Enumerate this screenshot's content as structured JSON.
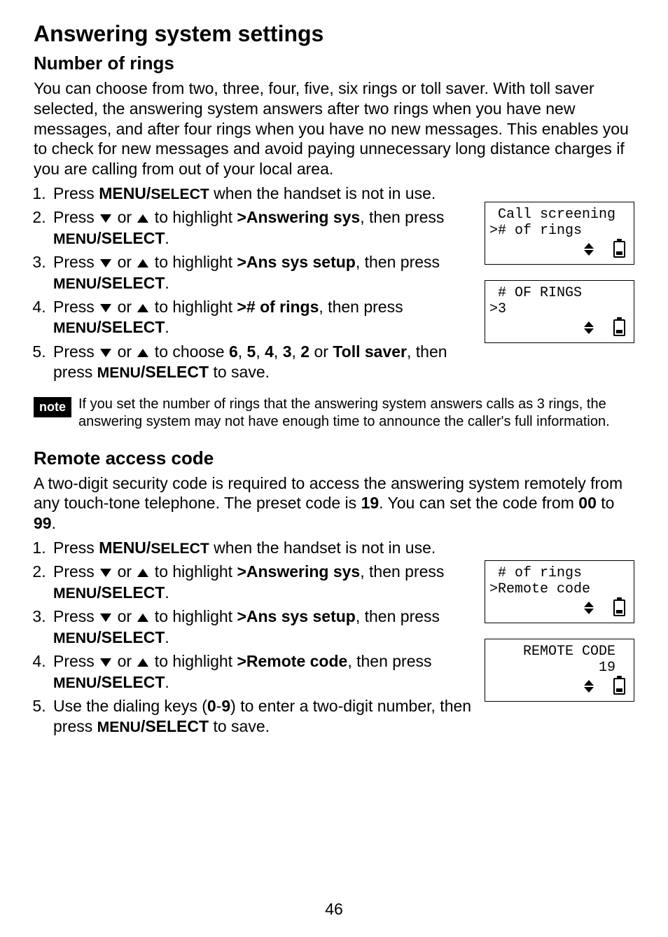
{
  "page": {
    "title": "Answering system settings",
    "number": "46"
  },
  "section1": {
    "heading": "Number of rings",
    "intro": "You can choose from two, three, four, five, six rings or toll saver. With toll saver selected, the answering system answers after two rings when you have new messages, and after four rings when you have no new messages. This enables you to check for new messages and avoid paying unnecessary long distance charges if you are calling from out of your local area.",
    "steps": {
      "s1_a": "Press ",
      "s1_b": "MENU/",
      "s1_c": "SELECT",
      "s1_d": " when the handset is not in use.",
      "s2_a": "Press ",
      "s2_or": " or ",
      "s2_b": " to highlight ",
      "s2_c": ">Answering sys",
      "s2_d": ", then press ",
      "s2_e": "MENU",
      "s2_f": "/SELECT",
      "s2_g": ".",
      "s3_a": "Press ",
      "s3_or": " or ",
      "s3_b": " to highlight ",
      "s3_c": ">Ans sys setup",
      "s3_d": ", then press ",
      "s3_e": "MENU",
      "s3_f": "/SELECT",
      "s3_g": ".",
      "s4_a": "Press ",
      "s4_or": " or ",
      "s4_b": " to highlight ",
      "s4_c": "># of rings",
      "s4_d": ", then press ",
      "s4_e": "MENU",
      "s4_f": "/SELECT",
      "s4_g": ".",
      "s5_a": "Press ",
      "s5_or": " or ",
      "s5_b": " to choose ",
      "s5_c6": "6",
      "s5_c5": "5",
      "s5_c4": "4",
      "s5_c3": "3",
      "s5_c2": "2",
      "s5_cor": " or ",
      "s5_ct": "Toll saver",
      "s5_d": ", then press ",
      "s5_e": "MENU",
      "s5_f": "/SELECT",
      "s5_g": " to save.",
      "s5_comma": ", "
    }
  },
  "note": {
    "label": "note",
    "text": "If you set the number of rings that the answering system answers calls as 3 rings, the answering system may not have enough time to announce the caller's full information."
  },
  "section2": {
    "heading": "Remote access code",
    "intro_a": "A two-digit security code is required to access the answering system remotely from any touch-tone telephone. The preset code is ",
    "intro_b": "19",
    "intro_c": ". You can set the code from ",
    "intro_d": "00",
    "intro_e": " to ",
    "intro_f": "99",
    "intro_g": ".",
    "steps": {
      "s1_a": "Press ",
      "s1_b": "MENU/",
      "s1_c": "SELECT",
      "s1_d": " when the handset is not in use.",
      "s2_a": "Press ",
      "s2_or": " or ",
      "s2_b": " to highlight ",
      "s2_c": ">Answering sys",
      "s2_d": ", then press ",
      "s2_e": "MENU",
      "s2_f": "/SELECT",
      "s2_g": ".",
      "s3_a": "Press ",
      "s3_or": " or ",
      "s3_b": " to highlight ",
      "s3_c": ">Ans sys setup",
      "s3_d": ", then press ",
      "s3_e": "MENU",
      "s3_f": "/SELECT",
      "s3_g": ".",
      "s4_a": "Press ",
      "s4_or": " or ",
      "s4_b": " to highlight ",
      "s4_c": ">Remote code",
      "s4_d": ", then press ",
      "s4_e": "MENU",
      "s4_f": "/SELECT",
      "s4_g": ".",
      "s5_a": "Use the dialing keys (",
      "s5_b": "0",
      "s5_c": "-",
      "s5_d": "9",
      "s5_e": ") to enter a two-digit number, then press ",
      "s5_f": "MENU",
      "s5_g": "/SELECT",
      "s5_h": " to save."
    }
  },
  "lcd1": {
    "line1": " Call screening",
    "line2": "># of rings"
  },
  "lcd2": {
    "line1": " # OF RINGS",
    "line2": ">3"
  },
  "lcd3": {
    "line1": " # of rings",
    "line2": ">Remote code"
  },
  "lcd4": {
    "line1": "    REMOTE CODE",
    "line2": "             19"
  }
}
